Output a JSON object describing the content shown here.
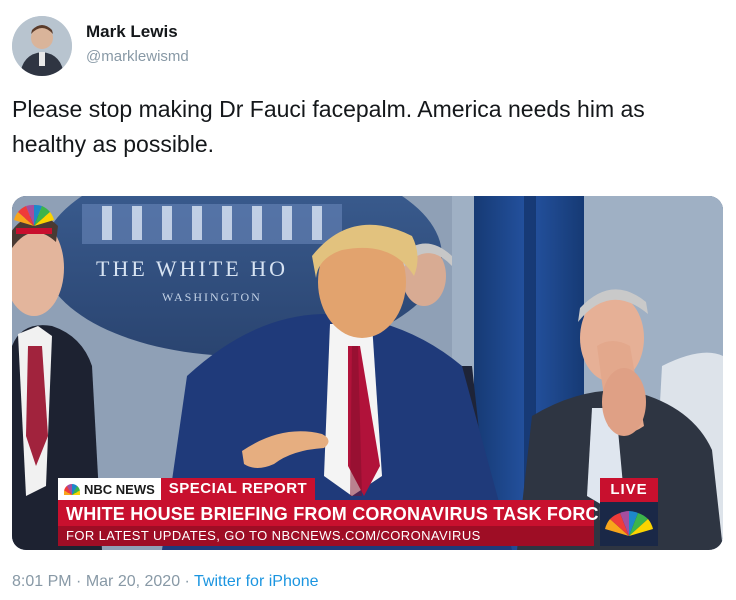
{
  "author": {
    "name": "Mark Lewis",
    "handle": "@marklewismd",
    "avatar_icon": "user-avatar"
  },
  "tweet": {
    "text": "Please stop making Dr Fauci facepalm. America needs him as healthy as possible."
  },
  "media": {
    "background_text": "THE WHITE HO",
    "background_subtext": "WASHINGTON",
    "nbc_news_tag": "NBC NEWS",
    "special_report_tag": "SPECIAL REPORT",
    "headline": "WHITE HOUSE BRIEFING FROM CORONAVIRUS TASK FORCE",
    "subheadline": "FOR LATEST UPDATES, GO TO NBCNEWS.COM/CORONAVIRUS",
    "live_tag": "LIVE",
    "logo_icon": "nbc-peacock-icon",
    "brand_color": "#c8102e"
  },
  "footer": {
    "time": "8:01 PM",
    "separator": " · ",
    "date": "Mar 20, 2020",
    "source": "Twitter for iPhone"
  }
}
